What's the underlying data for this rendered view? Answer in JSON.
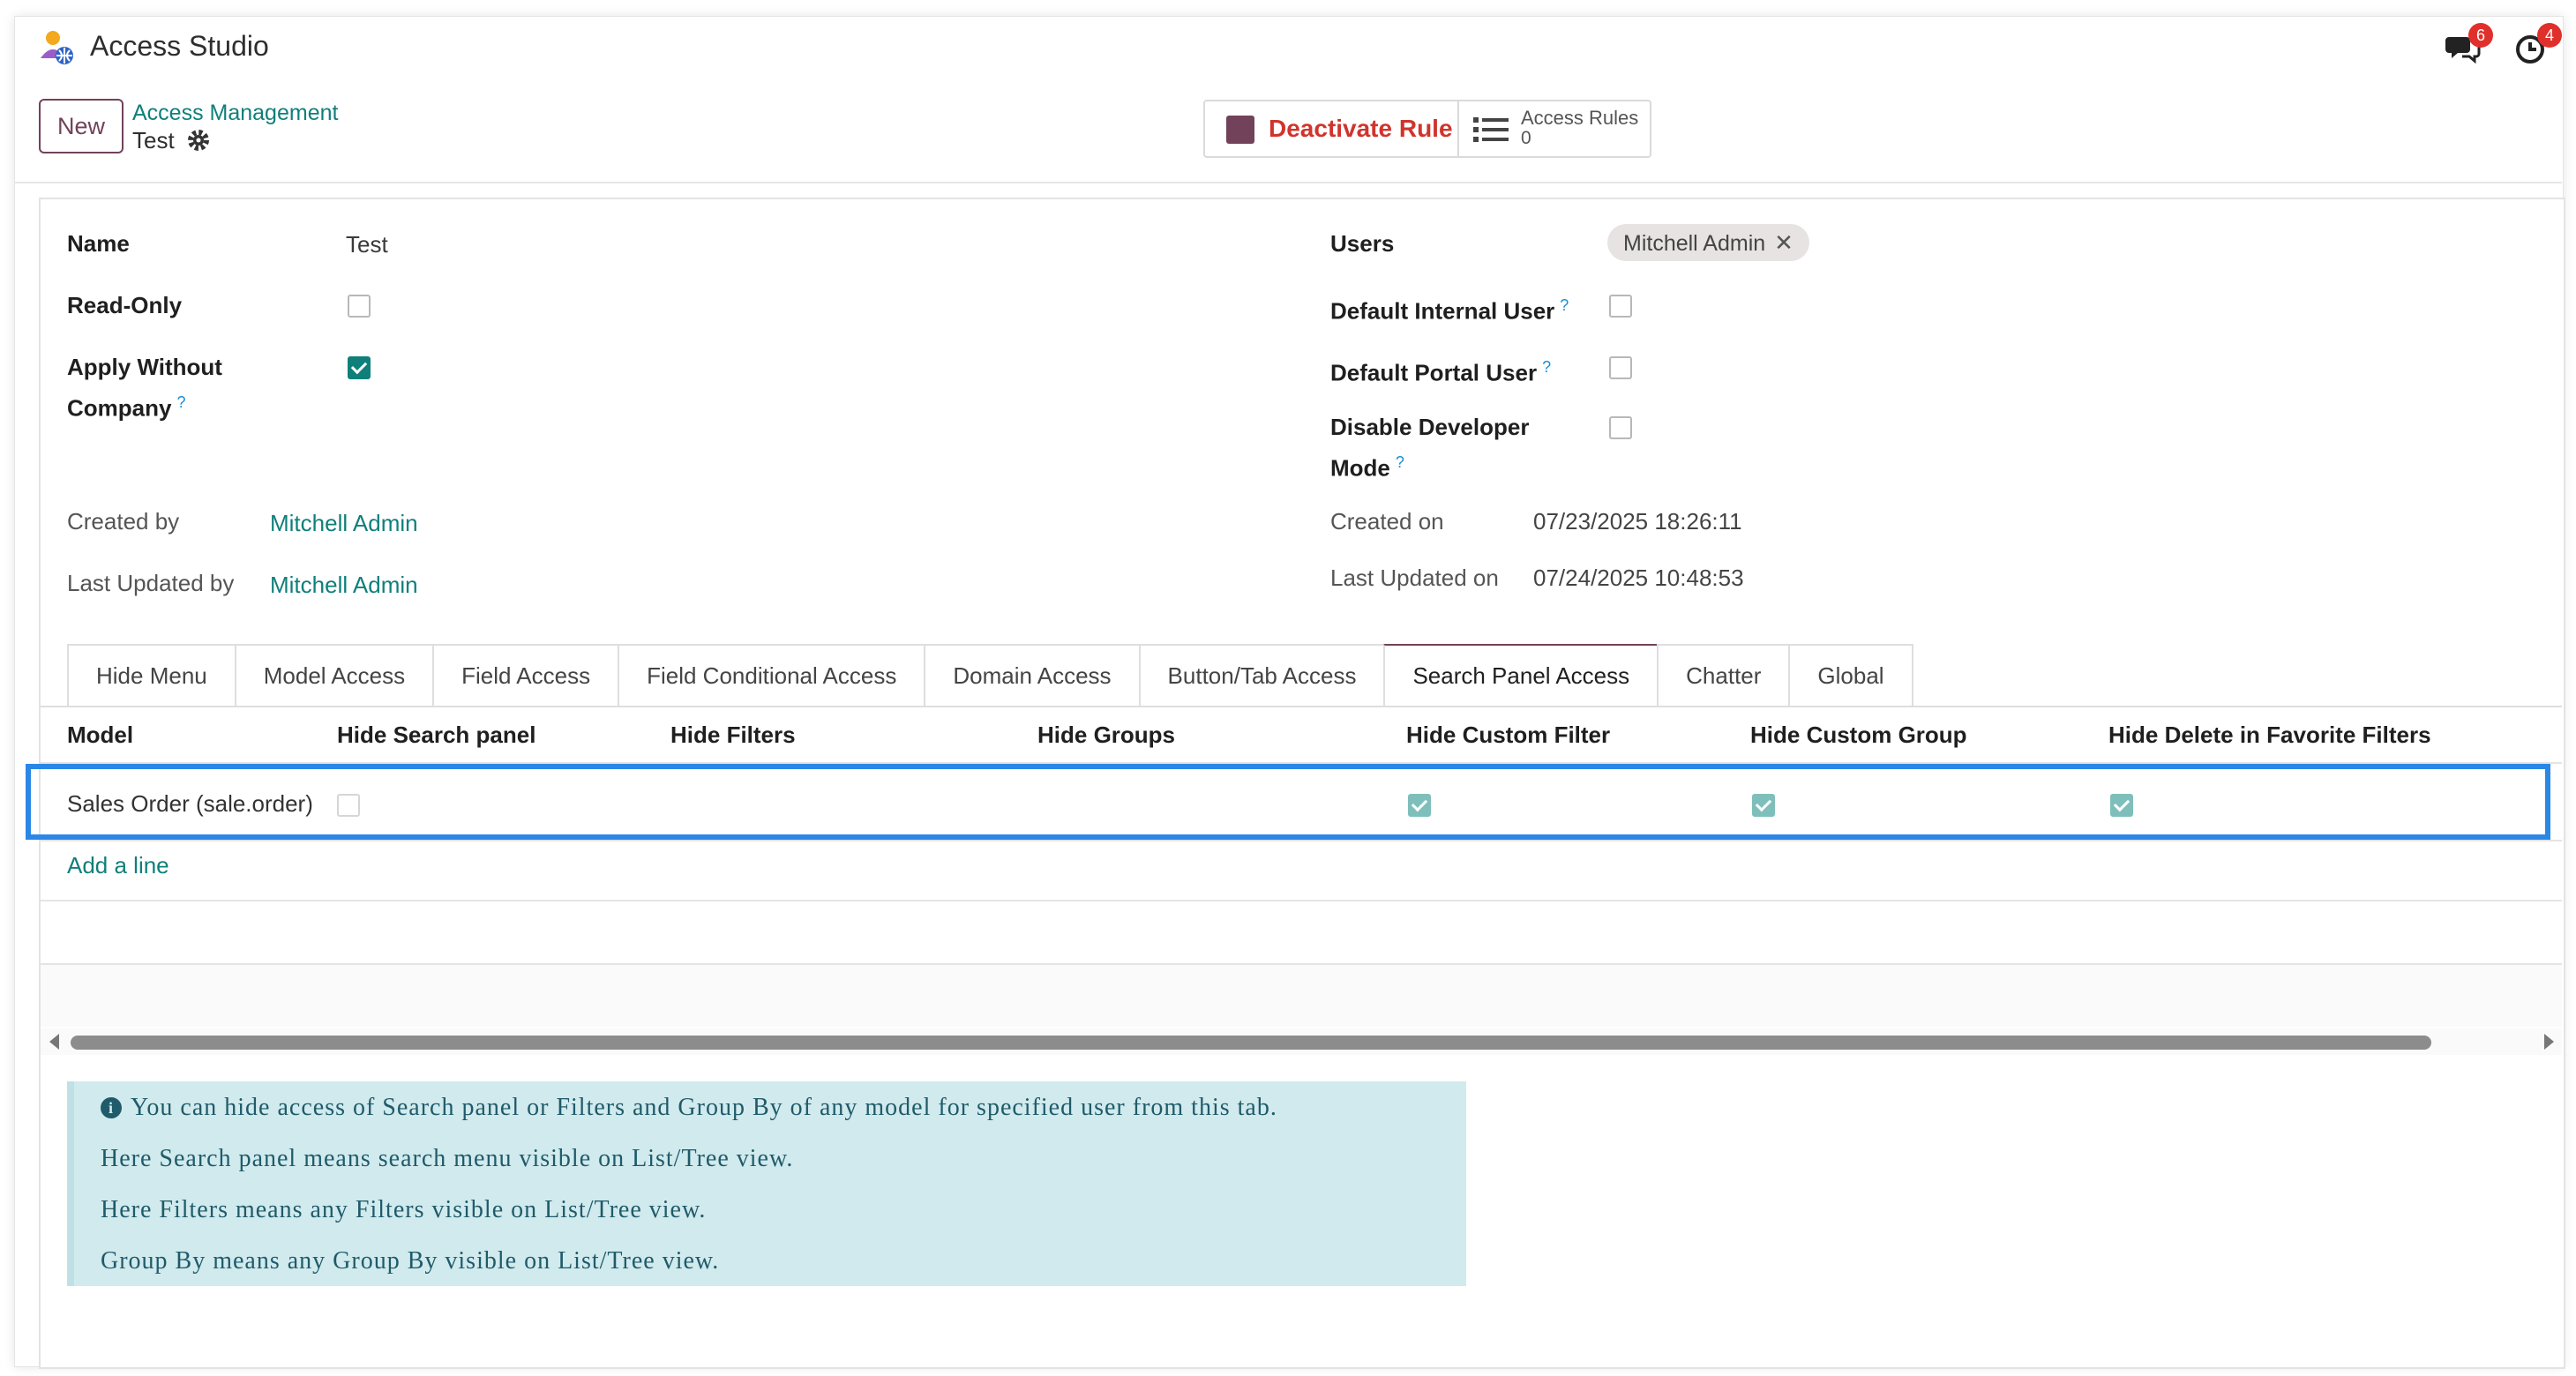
{
  "topbar": {
    "app_title": "Access Studio",
    "messages_badge": "6",
    "activities_badge": "4"
  },
  "control_panel": {
    "new_label": "New",
    "breadcrumb_parent": "Access Management",
    "breadcrumb_current": "Test",
    "deactivate_label": "Deactivate Rule",
    "access_rules_label": "Access Rules",
    "access_rules_count": "0"
  },
  "form": {
    "name_label": "Name",
    "name_value": "Test",
    "readonly_label": "Read-Only",
    "readonly_checked": false,
    "apply_without_company_label_1": "Apply Without",
    "apply_without_company_label_2": "Company",
    "apply_without_company_checked": true,
    "help_mark": "?",
    "users_label": "Users",
    "users_tags": [
      "Mitchell Admin"
    ],
    "default_internal_label": "Default Internal User",
    "default_portal_label": "Default Portal User",
    "disable_dev_label_1": "Disable Developer",
    "disable_dev_label_2": "Mode",
    "created_by_label": "Created by",
    "created_by_value": "Mitchell Admin",
    "last_updated_by_label": "Last Updated by",
    "last_updated_by_value": "Mitchell Admin",
    "created_on_label": "Created on",
    "created_on_value": "07/23/2025 18:26:11",
    "last_updated_on_label": "Last Updated on",
    "last_updated_on_value": "07/24/2025 10:48:53"
  },
  "tabs": [
    "Hide Menu",
    "Model Access",
    "Field Access",
    "Field Conditional Access",
    "Domain Access",
    "Button/Tab Access",
    "Search Panel Access",
    "Chatter",
    "Global"
  ],
  "active_tab": "Search Panel Access",
  "table": {
    "columns": [
      "Model",
      "Hide Search panel",
      "Hide Filters",
      "Hide Groups",
      "Hide Custom Filter",
      "Hide Custom Group",
      "Hide Delete in Favorite Filters"
    ],
    "rows": [
      {
        "model": "Sales Order (sale.order)",
        "hide_search_panel": false,
        "hide_custom_filter": true,
        "hide_custom_group": true,
        "hide_delete_in_favorite_filters": true
      }
    ],
    "add_line": "Add a line"
  },
  "info": {
    "icon": "i",
    "lines": [
      "You can hide access of Search panel or Filters and Group By of any model for specified user from this tab.",
      "Here Search panel means search menu visible on List/Tree view.",
      "Here Filters means any Filters visible on List/Tree view.",
      "Group By means any Group By visible on List/Tree view."
    ]
  },
  "colors": {
    "brand": "#71425a",
    "link": "#0f7f7a",
    "highlight": "#2b87e6",
    "danger": "#d0342c",
    "info_bg": "#d1eaed"
  }
}
